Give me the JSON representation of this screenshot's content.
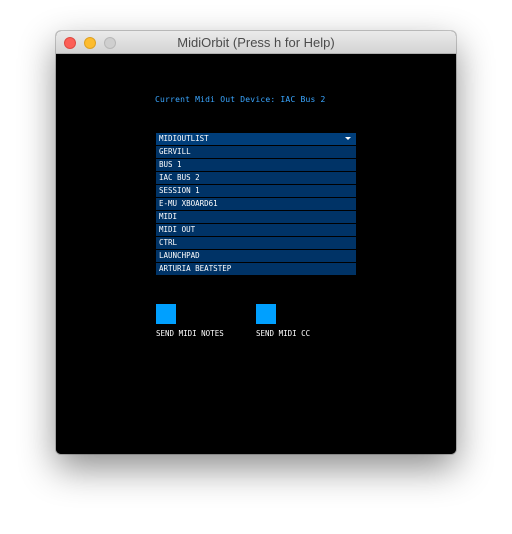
{
  "window": {
    "title": "MidiOrbit (Press h for Help)"
  },
  "colors": {
    "background": "#000000",
    "accent": "#00a0ff",
    "list_row": "#003366",
    "label_text": "#3aa6ff"
  },
  "current_device": {
    "text": "Current Midi Out Device: IAC Bus 2"
  },
  "midi_out_list": {
    "header": "MIDIOUTLIST",
    "items": [
      "GERVILL",
      "BUS 1",
      "IAC BUS 2",
      "SESSION 1",
      "E-MU XBOARD61",
      "MIDI",
      "MIDI OUT",
      "CTRL",
      "LAUNCHPAD",
      "ARTURIA BEATSTEP"
    ]
  },
  "toggles": {
    "send_notes_label": "SEND MIDI NOTES",
    "send_cc_label": "SEND MIDI CC"
  }
}
